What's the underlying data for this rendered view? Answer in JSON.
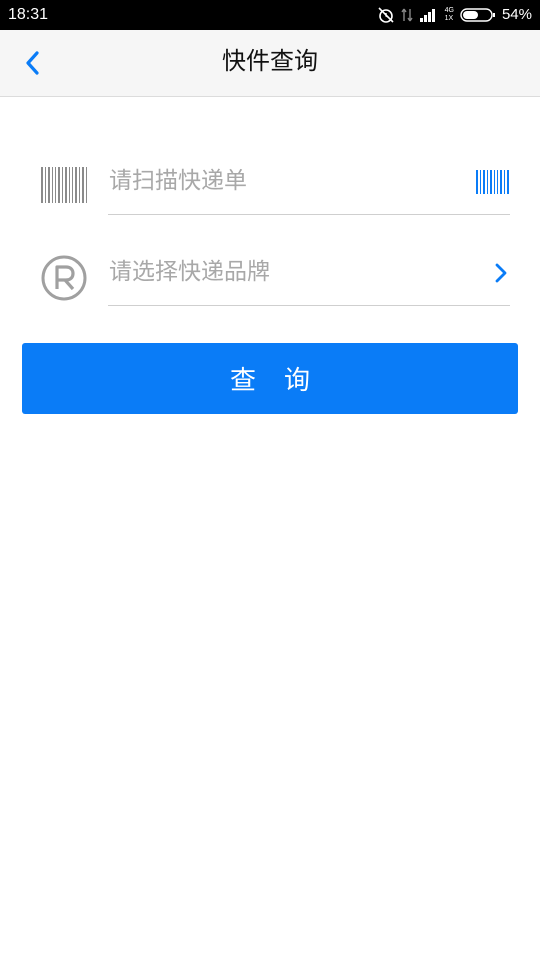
{
  "status_bar": {
    "time": "18:31",
    "network_top": "4G",
    "network_bottom": "1X",
    "battery": "54%",
    "icons": [
      "alarm-off-icon",
      "data-arrows-icon",
      "signal-icon",
      "signal-icon",
      "battery-icon"
    ]
  },
  "nav": {
    "title": "快件查询",
    "back_icon": "chevron-left-icon"
  },
  "form": {
    "scan": {
      "placeholder": "请扫描快递单",
      "icon": "barcode-icon",
      "action_icon": "scan-barcode-icon"
    },
    "brand": {
      "placeholder": "请选择快递品牌",
      "icon": "registered-mark-icon",
      "action_icon": "chevron-right-icon"
    }
  },
  "query_button": {
    "label": "查询"
  },
  "colors": {
    "accent": "#0a7cf7",
    "placeholder": "#a8a8a8",
    "nav_background": "#f6f6f6"
  }
}
